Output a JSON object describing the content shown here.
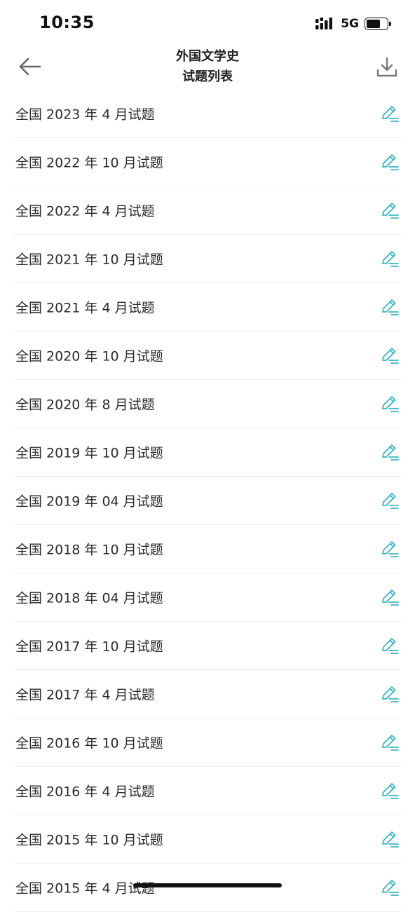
{
  "status_bar": {
    "time": "10:35",
    "network": "5G",
    "battery_level": 0.6
  },
  "header": {
    "title_line1": "外国文学史",
    "title_line2": "试题列表",
    "back_icon": "arrow-left-icon",
    "download_icon": "download-icon"
  },
  "colors": {
    "accent": "#3bb6c0",
    "text": "#2a2a2a",
    "divider": "#eeeeee"
  },
  "items": [
    {
      "label": "全国 2023 年 4 月试题"
    },
    {
      "label": "全国 2022 年 10 月试题"
    },
    {
      "label": "全国 2022 年 4 月试题"
    },
    {
      "label": "全国 2021 年 10 月试题"
    },
    {
      "label": "全国 2021 年 4 月试题"
    },
    {
      "label": "全国 2020 年 10 月试题"
    },
    {
      "label": "全国 2020 年 8 月试题"
    },
    {
      "label": "全国 2019 年 10 月试题"
    },
    {
      "label": "全国 2019 年 04 月试题"
    },
    {
      "label": "全国 2018 年 10 月试题"
    },
    {
      "label": "全国 2018 年 04 月试题"
    },
    {
      "label": "全国 2017 年 10 月试题"
    },
    {
      "label": "全国 2017 年 4 月试题"
    },
    {
      "label": "全国 2016 年 10 月试题"
    },
    {
      "label": "全国 2016 年 4 月试题"
    },
    {
      "label": "全国 2015 年 10 月试题"
    },
    {
      "label": "全国 2015 年 4 月试题"
    }
  ],
  "item_icon": "edit-pencil-icon"
}
